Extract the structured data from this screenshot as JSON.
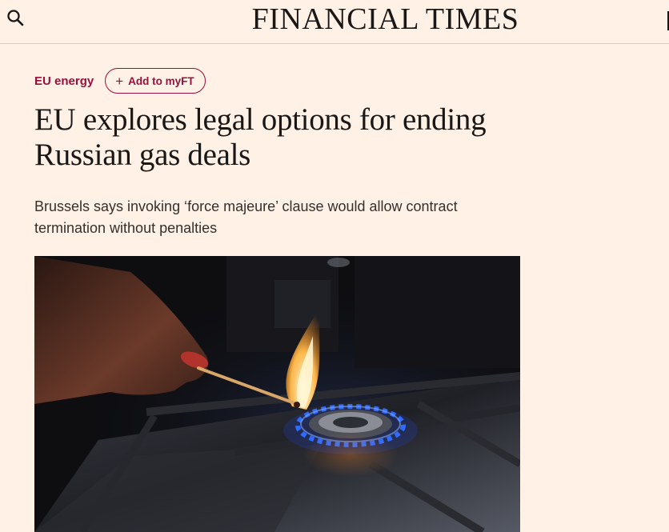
{
  "header": {
    "masthead": "FINANCIAL TIMES",
    "search_icon": "search-icon"
  },
  "article": {
    "topic": "EU energy",
    "myft_label": "Add to myFT",
    "myft_icon": "plus-icon",
    "headline": "EU explores legal options for ending Russian gas deals",
    "standfirst": "Brussels says invoking ‘force majeure’ clause would allow contract termination without penalties",
    "image_subject": "hand lighting a gas stove burner with a match"
  },
  "colors": {
    "background": "#fff1e5",
    "accent": "#990f3d",
    "text": "#1a1817",
    "flame_blue": "#2f6bff"
  }
}
